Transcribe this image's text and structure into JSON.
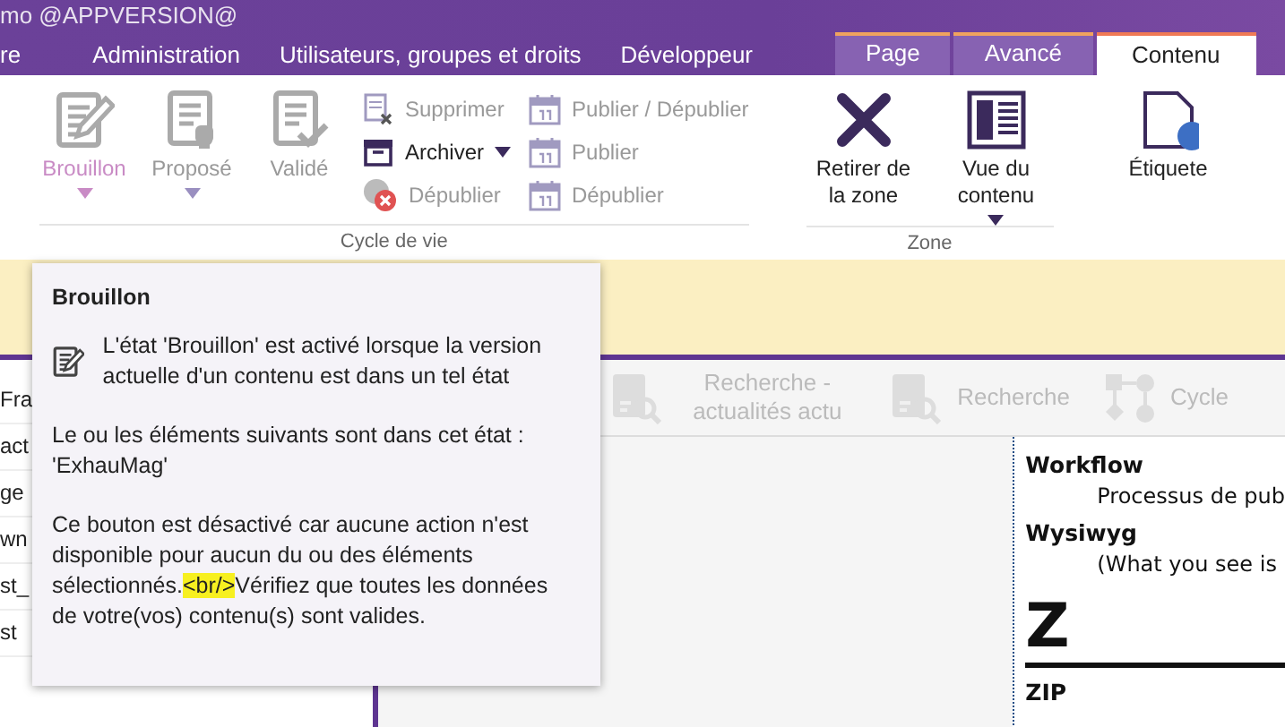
{
  "window": {
    "title": "mo @APPVERSION@"
  },
  "menu": [
    {
      "label": "re"
    },
    {
      "label": "Administration"
    },
    {
      "label": "Utilisateurs, groupes et droits"
    },
    {
      "label": "Développeur"
    }
  ],
  "context_tabs": [
    {
      "label": "Page",
      "selected": false
    },
    {
      "label": "Avancé",
      "selected": false
    },
    {
      "label": "Contenu",
      "selected": true
    }
  ],
  "ribbon": {
    "groups": [
      {
        "label": "Cycle de vie",
        "large": [
          {
            "label": "Brouillon",
            "kind": "draft",
            "highlighted": true,
            "disabled": true,
            "dropdown": true
          },
          {
            "label": "Proposé",
            "kind": "proposed",
            "highlighted": false,
            "disabled": true,
            "dropdown": true
          },
          {
            "label": "Validé",
            "kind": "validated",
            "highlighted": false,
            "disabled": true,
            "dropdown": false
          }
        ],
        "columns": [
          [
            {
              "label": "Supprimer",
              "kind": "delete",
              "disabled": true,
              "dropdown": false
            },
            {
              "label": "Archiver",
              "kind": "archive",
              "disabled": false,
              "dropdown": true
            },
            {
              "label": "Dépublier",
              "kind": "unpublish",
              "disabled": true,
              "dropdown": false
            }
          ],
          [
            {
              "label": "Publier / Dépublier",
              "kind": "calendar",
              "disabled": true,
              "dropdown": false
            },
            {
              "label": "Publier",
              "kind": "calendar",
              "disabled": true,
              "dropdown": false
            },
            {
              "label": "Dépublier",
              "kind": "calendar",
              "disabled": true,
              "dropdown": false
            }
          ]
        ]
      },
      {
        "label": "Zone",
        "large": [
          {
            "label": "Retirer de la zone",
            "kind": "remove",
            "highlighted": false,
            "disabled": false,
            "dropdown": false
          },
          {
            "label": "Vue du contenu",
            "kind": "view",
            "highlighted": false,
            "disabled": false,
            "dropdown": true
          }
        ]
      },
      {
        "large": [
          {
            "label": "Étiquete",
            "kind": "tag",
            "highlighted": false,
            "disabled": false,
            "dropdown": false
          }
        ]
      }
    ]
  },
  "sidebar": {
    "items": [
      {
        "label": "Fra"
      },
      {
        "label": "act"
      },
      {
        "label": "ge"
      },
      {
        "label": "wn"
      },
      {
        "label": "st_"
      },
      {
        "label": "st"
      }
    ]
  },
  "toolbar": [
    {
      "label": "Recherche - actualités actu",
      "kind": "search-doc",
      "disabled": true
    },
    {
      "label": "Recherche",
      "kind": "search-doc",
      "disabled": true
    },
    {
      "label": "Cycle",
      "kind": "workflow",
      "disabled": true
    }
  ],
  "document": [
    {
      "kind": "term",
      "text": "Workflow"
    },
    {
      "kind": "definition",
      "text": "Processus de pub"
    },
    {
      "kind": "term",
      "text": "Wysiwyg"
    },
    {
      "kind": "definition",
      "text": "(What you see is"
    },
    {
      "kind": "letter",
      "text": "Z"
    },
    {
      "kind": "term",
      "text": "ZIP"
    }
  ],
  "tooltip": {
    "title": "Brouillon",
    "description": "L'état 'Brouillon' est activé lorsque la version actuelle d'un contenu est dans un tel état",
    "items_text": "Le ou les éléments suivants sont dans cet état : 'ExhauMag'",
    "reason": {
      "before": "Ce bouton est désactivé car aucune action n'est disponible pour aucun du ou des éléments sélectionnés.",
      "highlighted": "<br/>",
      "after": "Vérifiez que toutes les données de votre(vos) contenu(s) sont valides."
    }
  }
}
